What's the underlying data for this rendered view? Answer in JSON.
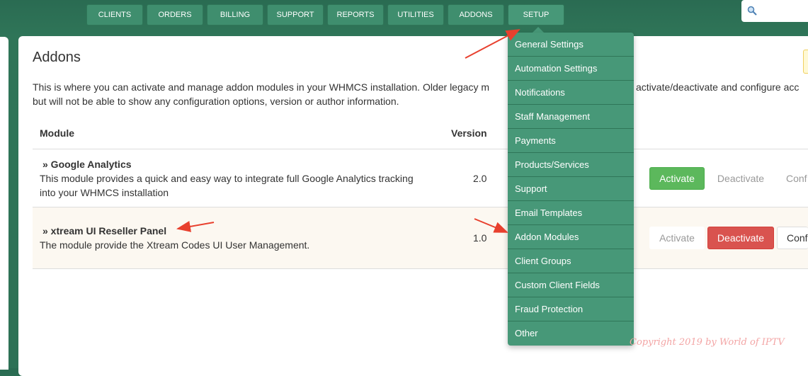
{
  "nav": {
    "items": [
      "CLIENTS",
      "ORDERS",
      "BILLING",
      "SUPPORT",
      "REPORTS",
      "UTILITIES",
      "ADDONS",
      "SETUP"
    ],
    "active": "SETUP"
  },
  "page": {
    "title": "Addons",
    "intro_line1": "This is where you can activate and manage addon modules in your WHMCS installation. Older legacy m",
    "intro_line1_tail": "activate/deactivate and configure acc",
    "intro_line2": "but will not be able to show any configuration options, version or author information."
  },
  "table": {
    "headers": {
      "module": "Module",
      "version": "Version"
    },
    "rows": [
      {
        "name": "» Google Analytics",
        "description_line1": "This module provides a quick and easy way to integrate full Google Analytics tracking",
        "description_line2": "into your WHMCS installation",
        "version": "2.0",
        "activate": "Activate",
        "deactivate": "Deactivate",
        "configure": "Conf"
      },
      {
        "name": "» xtream UI Reseller Panel",
        "description_line1": "The module provide the Xtream Codes UI User Management.",
        "version": "1.0",
        "activate": "Activate",
        "deactivate": "Deactivate",
        "configure": "Conf"
      }
    ]
  },
  "setup_menu": [
    "General Settings",
    "Automation Settings",
    "Notifications",
    "Staff Management",
    "Payments",
    "Products/Services",
    "Support",
    "Email Templates",
    "Addon Modules",
    "Client Groups",
    "Custom Client Fields",
    "Fraud Protection",
    "Other"
  ],
  "watermark": "Copyright 2019 by World of IPTV",
  "colors": {
    "nav_bg": "#3f8e6e",
    "menu_bg": "#479878",
    "activate_green": "#5cb85c",
    "deactivate_red": "#d9534f",
    "annotation_arrow": "#e8402e"
  }
}
